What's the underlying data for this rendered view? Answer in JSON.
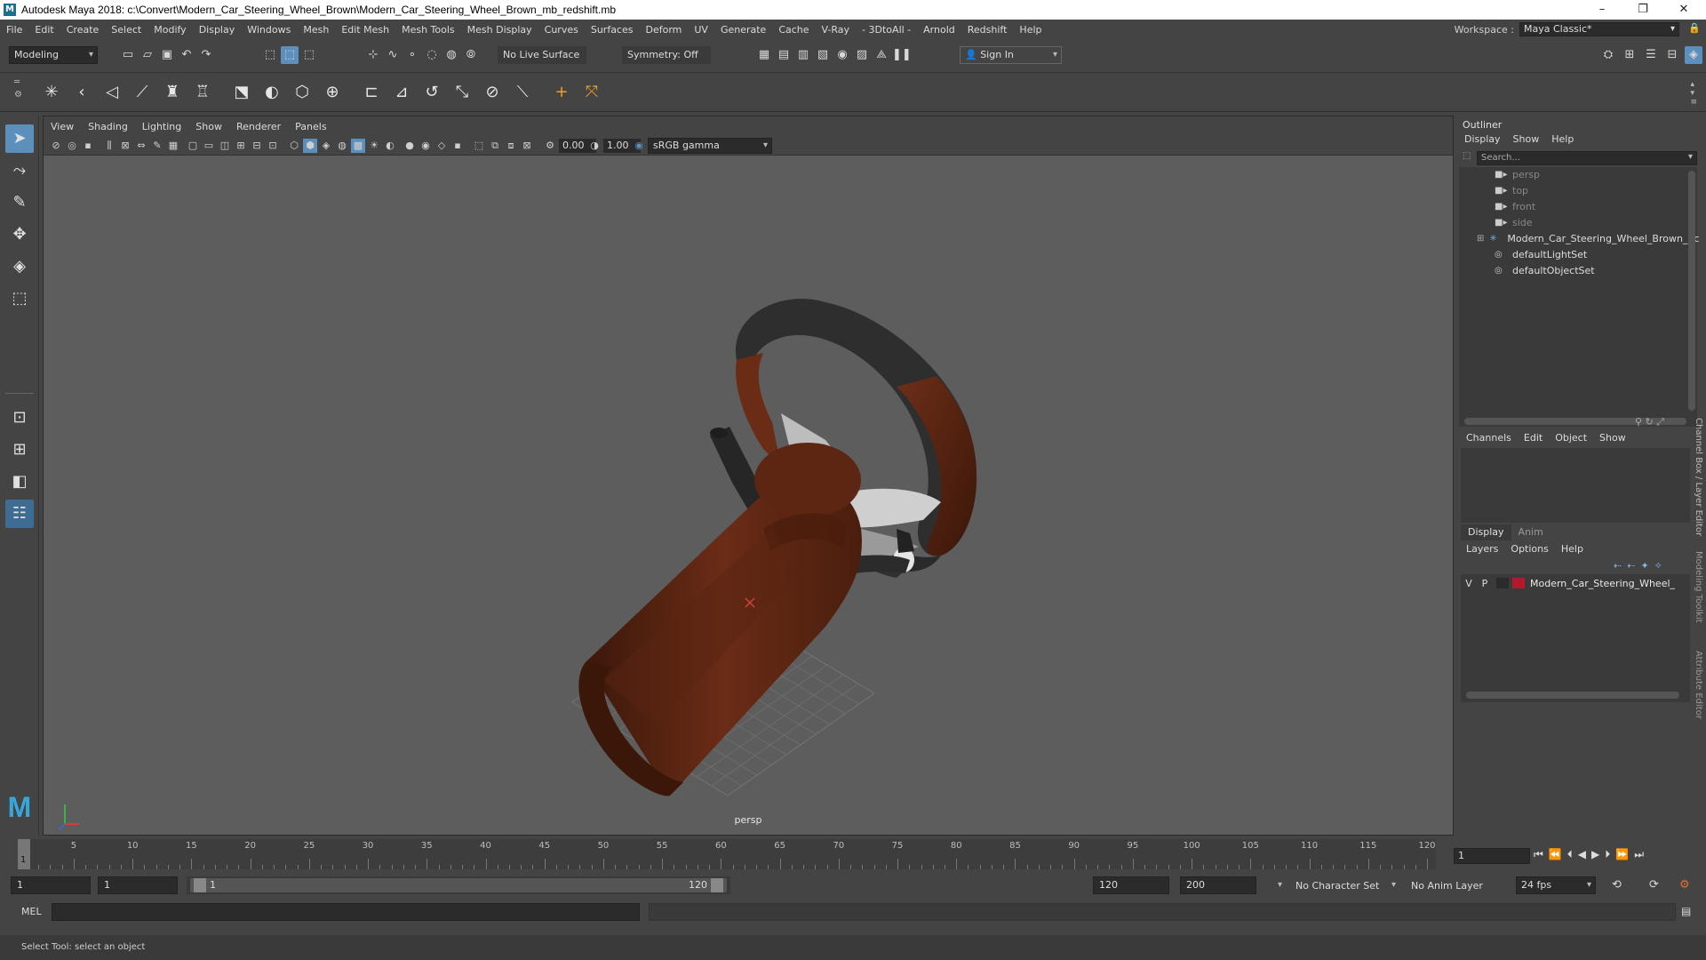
{
  "window": {
    "title": "Autodesk Maya 2018: c:\\Convert\\Modern_Car_Steering_Wheel_Brown\\Modern_Car_Steering_Wheel_Brown_mb_redshift.mb",
    "minimize": "–",
    "maximize": "❐",
    "close": "✕"
  },
  "menubar": {
    "items": [
      "File",
      "Edit",
      "Create",
      "Select",
      "Modify",
      "Display",
      "Windows",
      "Mesh",
      "Edit Mesh",
      "Mesh Tools",
      "Mesh Display",
      "Curves",
      "Surfaces",
      "Deform",
      "UV",
      "Generate",
      "Cache",
      "V-Ray",
      "- 3DtoAll -",
      "Arnold",
      "Redshift",
      "Help"
    ],
    "workspace_label": "Workspace :",
    "workspace_value": "Maya Classic*"
  },
  "statusline": {
    "mode": "Modeling",
    "live_surface": "No Live Surface",
    "symmetry": "Symmetry: Off",
    "sign_in": "Sign In"
  },
  "viewport": {
    "menus": [
      "View",
      "Shading",
      "Lighting",
      "Show",
      "Renderer",
      "Panels"
    ],
    "exposure": "0.00",
    "gamma": "1.00",
    "color_space": "sRGB gamma",
    "camera_label": "persp"
  },
  "outliner": {
    "title": "Outliner",
    "menus": [
      "Display",
      "Show",
      "Help"
    ],
    "search_placeholder": "Search...",
    "items": [
      {
        "label": "persp",
        "icon": "camera-icon",
        "dim": true
      },
      {
        "label": "top",
        "icon": "camera-icon",
        "dim": true
      },
      {
        "label": "front",
        "icon": "camera-icon",
        "dim": true
      },
      {
        "label": "side",
        "icon": "camera-icon",
        "dim": true
      },
      {
        "label": "Modern_Car_Steering_Wheel_Brown_nc",
        "icon": "transform-icon",
        "dim": false
      },
      {
        "label": "defaultLightSet",
        "icon": "set-icon",
        "dim": false
      },
      {
        "label": "defaultObjectSet",
        "icon": "set-icon",
        "dim": false
      }
    ]
  },
  "channelbox": {
    "menus": [
      "Channels",
      "Edit",
      "Object",
      "Show"
    ],
    "side_tab_1": "Channel Box / Layer Editor",
    "side_tab_2": "Modeling Toolkit",
    "side_tab_3": "Attribute Editor"
  },
  "layers": {
    "tabs": [
      "Display",
      "Anim"
    ],
    "menus": [
      "Layers",
      "Options",
      "Help"
    ],
    "layer": {
      "v": "V",
      "p": "P",
      "name": "Modern_Car_Steering_Wheel_",
      "color": "#b5172f"
    }
  },
  "timeline": {
    "ticks": [
      "5",
      "10",
      "15",
      "20",
      "25",
      "30",
      "35",
      "40",
      "45",
      "50",
      "55",
      "60",
      "65",
      "70",
      "75",
      "80",
      "85",
      "90",
      "95",
      "100",
      "105",
      "110",
      "115",
      "120"
    ],
    "current_marker": "1",
    "current_frame": "1"
  },
  "range": {
    "start": "1",
    "inner_start": "1",
    "slider_start": "1",
    "slider_end": "120",
    "end": "120",
    "total_end": "200",
    "character_set": "No Character Set",
    "anim_layer": "No Anim Layer",
    "fps": "24 fps"
  },
  "command": {
    "label": "MEL"
  },
  "help_line": "Select Tool: select an object",
  "colors": {
    "accent": "#5d8fbc",
    "wheel_brown": "#5a2412",
    "wheel_dark": "#2d2d2d"
  }
}
